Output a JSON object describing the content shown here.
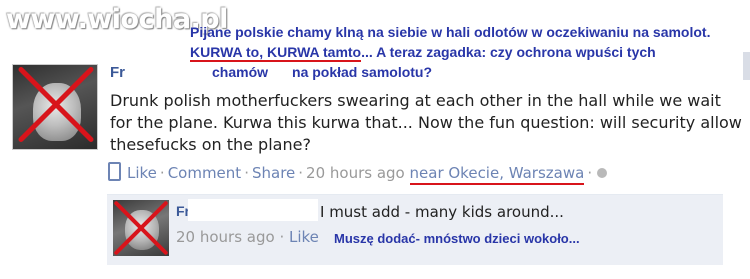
{
  "watermark": "www.wiocha.pl",
  "annotation": {
    "line1": "Pijane polskie chamy klną na siebie w hali odlotów w oczekiwaniu na samolot.",
    "line2_part1": "KURWA to, KURWA tamto",
    "line2_part2": "... A teraz zagadka: czy ochrona wpuści tych",
    "line3_part1": "chamów",
    "line3_part2": "na pokład samolotu?"
  },
  "post": {
    "author": "Fr",
    "text": "Drunk polish motherfuckers swearing at each other in the hall while we wait for the plane. Kurwa this kurwa that... Now the fun question: will security allow thesefucks on the plane?",
    "actions": {
      "like": "Like",
      "comment": "Comment",
      "share": "Share",
      "time": "20 hours ago",
      "place": "near Okecie, Warszawa"
    }
  },
  "comment": {
    "author": "Fr",
    "text": "I must add - many kids around...",
    "time": "20 hours ago",
    "like": "Like",
    "annotation": "Muszę dodać- mnóstwo dzieci wokoło..."
  },
  "colors": {
    "fb_link": "#6d84b4",
    "fb_name": "#3b5998",
    "annotation_blue": "#2936a8",
    "red_mark": "#d8141b"
  }
}
